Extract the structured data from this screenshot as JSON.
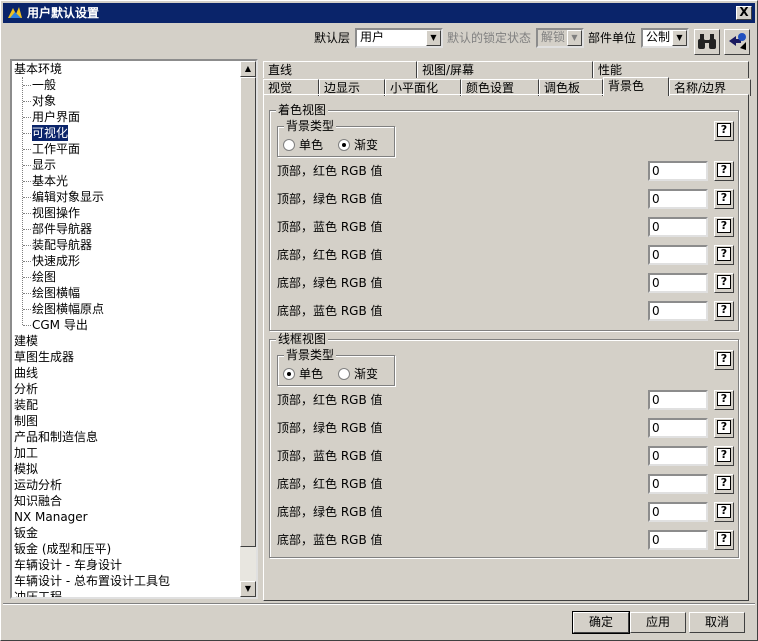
{
  "window": {
    "title": "用户默认设置",
    "close": "X"
  },
  "toolbar": {
    "default_layer_label": "默认层",
    "default_layer_value": "用户",
    "lock_state_label": "默认的锁定状态",
    "lock_state_value": "解锁",
    "unit_label": "部件单位",
    "unit_value": "公制"
  },
  "tree": {
    "items": [
      {
        "label": "基本环境",
        "level": 0
      },
      {
        "label": "一般",
        "level": 1
      },
      {
        "label": "对象",
        "level": 1
      },
      {
        "label": "用户界面",
        "level": 1
      },
      {
        "label": "可视化",
        "level": 1,
        "selected": true
      },
      {
        "label": "工作平面",
        "level": 1
      },
      {
        "label": "显示",
        "level": 1
      },
      {
        "label": "基本光",
        "level": 1
      },
      {
        "label": "编辑对象显示",
        "level": 1
      },
      {
        "label": "视图操作",
        "level": 1
      },
      {
        "label": "部件导航器",
        "level": 1
      },
      {
        "label": "装配导航器",
        "level": 1
      },
      {
        "label": "快速成形",
        "level": 1
      },
      {
        "label": "绘图",
        "level": 1
      },
      {
        "label": "绘图横幅",
        "level": 1
      },
      {
        "label": "绘图横幅原点",
        "level": 1
      },
      {
        "label": "CGM 导出",
        "level": 1
      },
      {
        "label": "建模",
        "level": 0
      },
      {
        "label": "草图生成器",
        "level": 0
      },
      {
        "label": "曲线",
        "level": 0
      },
      {
        "label": "分析",
        "level": 0
      },
      {
        "label": "装配",
        "level": 0
      },
      {
        "label": "制图",
        "level": 0
      },
      {
        "label": "产品和制造信息",
        "level": 0
      },
      {
        "label": "加工",
        "level": 0
      },
      {
        "label": "模拟",
        "level": 0
      },
      {
        "label": "运动分析",
        "level": 0
      },
      {
        "label": "知识融合",
        "level": 0
      },
      {
        "label": "NX Manager",
        "level": 0
      },
      {
        "label": "钣金",
        "level": 0
      },
      {
        "label": "钣金 (成型和压平)",
        "level": 0
      },
      {
        "label": "车辆设计 - 车身设计",
        "level": 0
      },
      {
        "label": "车辆设计 - 总布置设计工具包",
        "level": 0
      },
      {
        "label": "冲压工程",
        "level": 0
      }
    ]
  },
  "tabs": {
    "row1": [
      "直线",
      "视图/屏幕",
      "性能"
    ],
    "row2": [
      "视觉",
      "边显示",
      "小平面化",
      "颜色设置",
      "调色板",
      "背景色",
      "名称/边界"
    ],
    "active": "背景色"
  },
  "shaded": {
    "title": "着色视图",
    "bg_type_label": "背景类型",
    "opt_single": "单色",
    "opt_gradient": "渐变",
    "selected": "渐变",
    "fields": [
      {
        "label": "顶部，红色 RGB 值",
        "value": "0"
      },
      {
        "label": "顶部，绿色 RGB 值",
        "value": "0"
      },
      {
        "label": "顶部，蓝色 RGB 值",
        "value": "0"
      },
      {
        "label": "底部，红色 RGB 值",
        "value": "0"
      },
      {
        "label": "底部，绿色 RGB 值",
        "value": "0"
      },
      {
        "label": "底部，蓝色 RGB 值",
        "value": "0"
      }
    ]
  },
  "wireframe": {
    "title": "线框视图",
    "bg_type_label": "背景类型",
    "opt_single": "单色",
    "opt_gradient": "渐变",
    "selected": "单色",
    "fields": [
      {
        "label": "顶部，红色 RGB 值",
        "value": "0"
      },
      {
        "label": "顶部，绿色 RGB 值",
        "value": "0"
      },
      {
        "label": "顶部，蓝色 RGB 值",
        "value": "0"
      },
      {
        "label": "底部，红色 RGB 值",
        "value": "0"
      },
      {
        "label": "底部，绿色 RGB 值",
        "value": "0"
      },
      {
        "label": "底部，蓝色 RGB 值",
        "value": "0"
      }
    ]
  },
  "buttons": {
    "ok": "确定",
    "apply": "应用",
    "cancel": "取消"
  },
  "help_symbol": "?"
}
